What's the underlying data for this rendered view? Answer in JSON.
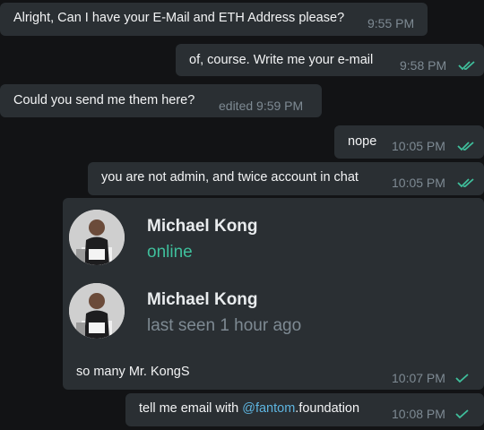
{
  "messages": [
    {
      "text": "Alright, Can I have your E-Mail and ETH Address please?",
      "time": "9:55 PM"
    },
    {
      "text": "of, course. Write me your e-mail",
      "time": "9:58 PM",
      "ticks": "double-check-icon"
    },
    {
      "text": "Could you send me them here?",
      "time": "edited 9:59 PM"
    },
    {
      "text": "nope",
      "time": "10:05 PM",
      "ticks": "double-check-icon"
    },
    {
      "text": "you are not admin, and twice account in chat",
      "time": "10:05 PM",
      "ticks": "double-check-icon"
    },
    {
      "contacts": [
        {
          "name": "Michael Kong",
          "status": "online",
          "status_color": "#3fbf9c"
        },
        {
          "name": "Michael Kong",
          "status": "last seen 1 hour ago",
          "status_color": "#7e8a93"
        }
      ],
      "text": "so many Mr. KongS",
      "time": "10:07 PM",
      "ticks": "single-check-icon"
    },
    {
      "text_before": "tell me email with ",
      "mention": "@fantom",
      "text_after": ".foundation",
      "time": "10:08 PM",
      "ticks": "single-check-icon"
    }
  ],
  "colors": {
    "background": "#121315",
    "bubble": "#2a2f33",
    "text": "#f3f4f5",
    "meta": "#7e8a93",
    "accent": "#3fbf9c",
    "mention": "#5eb5e0"
  }
}
